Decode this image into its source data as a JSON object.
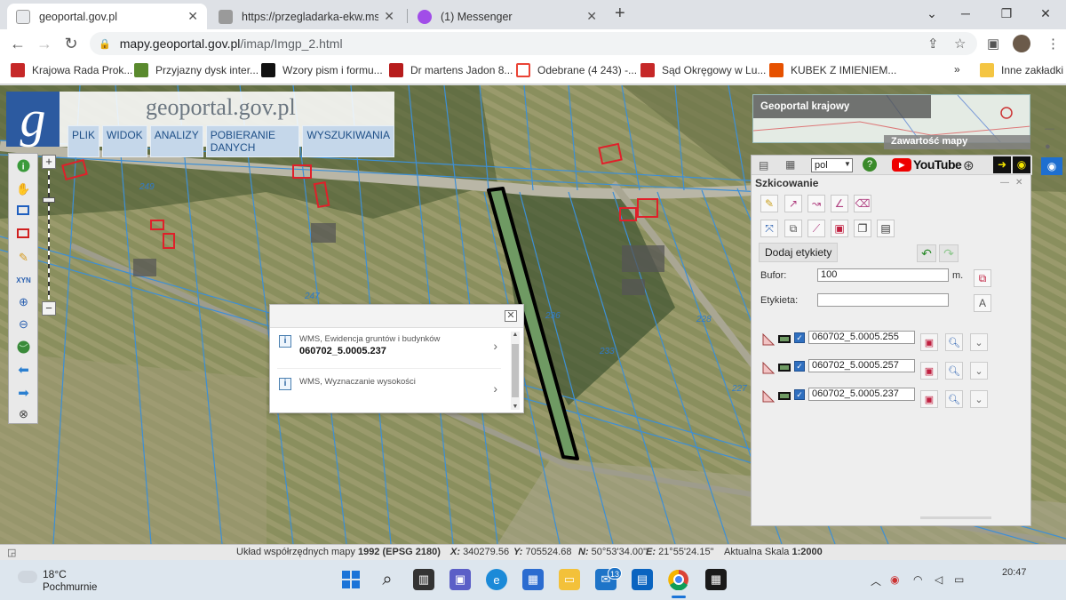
{
  "browser": {
    "tabs": [
      {
        "label": "geoportal.gov.pl",
        "active": true,
        "favicon": "#e8eaed"
      },
      {
        "label": "https://przegladarka-ekw.ms.gov",
        "active": false,
        "favicon": "#9a9a9a"
      },
      {
        "label": "(1) Messenger",
        "active": false,
        "favicon": "#a14de8"
      }
    ],
    "new_tab_label": "+",
    "url_host": "mapy.geoportal.gov.pl",
    "url_path": "/imap/Imgp_2.html",
    "bookmarks": [
      {
        "label": "Krajowa Rada Prok...",
        "color": "#c62828"
      },
      {
        "label": "Przyjazny dysk inter...",
        "color": "#5a8a2e"
      },
      {
        "label": "Wzory pism i formu...",
        "color": "#111111"
      },
      {
        "label": "Dr martens Jadon 8...",
        "color": "#b71c1c"
      },
      {
        "label": "Odebrane (4 243) -...",
        "color": "#ea4335"
      },
      {
        "label": "Sąd Okręgowy w Lu...",
        "color": "#c62828"
      },
      {
        "label": "KUBEK Z IMIENIEM...",
        "color": "#e65100"
      },
      {
        "label": "Inne zakładki",
        "color": "#f4c542"
      }
    ],
    "bookmarks_more": "»"
  },
  "geoportal": {
    "logo_letter": "g",
    "site_title": "geoportal.gov.pl",
    "menu": [
      "PLIK",
      "WIDOK",
      "ANALIZY",
      "POBIERANIE DANYCH",
      "WYSZUKIWANIA"
    ],
    "thumb_title": "Geoportal krajowy",
    "zawartosc_label": "Zawartość mapy"
  },
  "tools": [
    "info-icon",
    "hand-icon",
    "zoom-box-icon",
    "select-icon",
    "pencil-icon",
    "xyz-icon",
    "zoom-in-icon",
    "zoom-out-icon",
    "globe-icon",
    "back-arrow-icon",
    "forward-arrow-icon",
    "full-extent-icon"
  ],
  "xyz_label": "XYN",
  "map_labels": [
    {
      "text": "249"
    },
    {
      "text": "247"
    },
    {
      "text": "236"
    },
    {
      "text": "233"
    },
    {
      "text": "228"
    },
    {
      "text": "227"
    }
  ],
  "popup": {
    "rows": [
      {
        "title": "WMS, Ewidencja gruntów i budynków",
        "value": "060702_5.0005.237"
      },
      {
        "title": "WMS, Wyznaczanie wysokości",
        "value": ""
      }
    ]
  },
  "sketch": {
    "lang": "pol",
    "youtube_label": "YouTube",
    "title": "Szkicowanie",
    "add_labels_button": "Dodaj etykiety",
    "buffer_label": "Bufor:",
    "buffer_value": "100",
    "buffer_unit": "m.",
    "label_label": "Etykieta:",
    "label_value": "",
    "layers": [
      {
        "id": "060702_5.0005.255",
        "checked": true
      },
      {
        "id": "060702_5.0005.257",
        "checked": true
      },
      {
        "id": "060702_5.0005.237",
        "checked": true
      }
    ]
  },
  "status": {
    "crs_prefix": "Układ współrzędnych mapy",
    "crs_value": "1992 (EPSG 2180)",
    "x_label": "X:",
    "x_value": "340279.56",
    "y_label": "Y:",
    "y_value": "705524.68",
    "n_label": "N:",
    "n_value": "50°53'34.00\"",
    "e_label": "E:",
    "e_value": "21°55'24.15\"",
    "scale_label": "Aktualna Skala",
    "scale_value": "1:2000"
  },
  "taskbar": {
    "weather_temp": "18°C",
    "weather_desc": "Pochmurnie",
    "mail_badge": "13",
    "time": "20:47"
  },
  "colors": {
    "parcel_fill": "#6f9a63",
    "parcel_outline": "#000000",
    "cadastre_lines": "#3d8fd6",
    "building_outline": "#e0202a",
    "menu_bg": "#c5d7ea"
  }
}
